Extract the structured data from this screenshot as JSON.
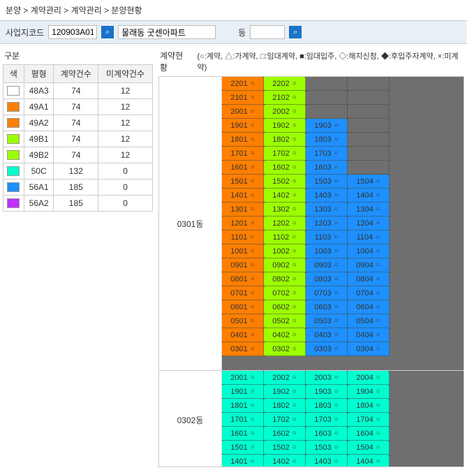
{
  "breadcrumb": "분양 > 계약관리 > 계약관리 > 분양현황",
  "filter": {
    "code_label": "사업지코드",
    "code_value": "120903A01",
    "name_value": "물래동 굿센아파트",
    "dong_label": "동",
    "dong_value": ""
  },
  "left": {
    "title": "구분",
    "headers": [
      "색",
      "평형",
      "계약건수",
      "미계약건수"
    ],
    "rows": [
      {
        "color": "#ffffff",
        "type": "48A3",
        "contract": 74,
        "nocontract": 12
      },
      {
        "color": "#ff7f00",
        "type": "49A1",
        "contract": 74,
        "nocontract": 12
      },
      {
        "color": "#ff7f00",
        "type": "49A2",
        "contract": 74,
        "nocontract": 12
      },
      {
        "color": "#9cff00",
        "type": "49B1",
        "contract": 74,
        "nocontract": 12
      },
      {
        "color": "#9cff00",
        "type": "49B2",
        "contract": 74,
        "nocontract": 12
      },
      {
        "color": "#00ffd0",
        "type": "50C",
        "contract": 132,
        "nocontract": 0
      },
      {
        "color": "#1e90ff",
        "type": "56A1",
        "contract": 185,
        "nocontract": 0
      },
      {
        "color": "#c030ff",
        "type": "56A2",
        "contract": 185,
        "nocontract": 0
      }
    ]
  },
  "right": {
    "title": "계약현황",
    "legend": "(○:계약, △:가계약, □:임대계약, ■:임대입주, ◇:해지신청, ◆:후입주자계약, ×:미계약)",
    "buildings": [
      {
        "name": "0301동",
        "sym": "○",
        "rows": [
          [
            {
              "u": "2201",
              "c": "#ff7f00"
            },
            {
              "u": "2202",
              "c": "#9cff00"
            },
            null,
            null
          ],
          [
            {
              "u": "2101",
              "c": "#ff7f00"
            },
            {
              "u": "2102",
              "c": "#9cff00"
            },
            null,
            null
          ],
          [
            {
              "u": "2001",
              "c": "#ff7f00"
            },
            {
              "u": "2002",
              "c": "#9cff00"
            },
            null,
            null
          ],
          [
            {
              "u": "1901",
              "c": "#ff7f00"
            },
            {
              "u": "1902",
              "c": "#9cff00"
            },
            {
              "u": "1903",
              "c": "#1e90ff"
            },
            null
          ],
          [
            {
              "u": "1801",
              "c": "#ff7f00"
            },
            {
              "u": "1802",
              "c": "#9cff00"
            },
            {
              "u": "1803",
              "c": "#1e90ff"
            },
            null
          ],
          [
            {
              "u": "1701",
              "c": "#ff7f00"
            },
            {
              "u": "1702",
              "c": "#9cff00"
            },
            {
              "u": "1703",
              "c": "#1e90ff"
            },
            null
          ],
          [
            {
              "u": "1601",
              "c": "#ff7f00"
            },
            {
              "u": "1602",
              "c": "#9cff00"
            },
            {
              "u": "1603",
              "c": "#1e90ff"
            },
            null
          ],
          [
            {
              "u": "1501",
              "c": "#ff7f00"
            },
            {
              "u": "1502",
              "c": "#9cff00"
            },
            {
              "u": "1503",
              "c": "#1e90ff"
            },
            {
              "u": "1504",
              "c": "#1e90ff"
            }
          ],
          [
            {
              "u": "1401",
              "c": "#ff7f00"
            },
            {
              "u": "1402",
              "c": "#9cff00"
            },
            {
              "u": "1403",
              "c": "#1e90ff"
            },
            {
              "u": "1404",
              "c": "#1e90ff"
            }
          ],
          [
            {
              "u": "1301",
              "c": "#ff7f00"
            },
            {
              "u": "1302",
              "c": "#9cff00"
            },
            {
              "u": "1303",
              "c": "#1e90ff"
            },
            {
              "u": "1304",
              "c": "#1e90ff"
            }
          ],
          [
            {
              "u": "1201",
              "c": "#ff7f00"
            },
            {
              "u": "1202",
              "c": "#9cff00"
            },
            {
              "u": "1203",
              "c": "#1e90ff"
            },
            {
              "u": "1204",
              "c": "#1e90ff"
            }
          ],
          [
            {
              "u": "1101",
              "c": "#ff7f00"
            },
            {
              "u": "1102",
              "c": "#9cff00"
            },
            {
              "u": "1103",
              "c": "#1e90ff"
            },
            {
              "u": "1104",
              "c": "#1e90ff"
            }
          ],
          [
            {
              "u": "1001",
              "c": "#ff7f00"
            },
            {
              "u": "1002",
              "c": "#9cff00"
            },
            {
              "u": "1003",
              "c": "#1e90ff"
            },
            {
              "u": "1004",
              "c": "#1e90ff"
            }
          ],
          [
            {
              "u": "0901",
              "c": "#ff7f00"
            },
            {
              "u": "0902",
              "c": "#9cff00"
            },
            {
              "u": "0903",
              "c": "#1e90ff"
            },
            {
              "u": "0904",
              "c": "#1e90ff"
            }
          ],
          [
            {
              "u": "0801",
              "c": "#ff7f00"
            },
            {
              "u": "0802",
              "c": "#9cff00"
            },
            {
              "u": "0803",
              "c": "#1e90ff"
            },
            {
              "u": "0804",
              "c": "#1e90ff"
            }
          ],
          [
            {
              "u": "0701",
              "c": "#ff7f00"
            },
            {
              "u": "0702",
              "c": "#9cff00"
            },
            {
              "u": "0703",
              "c": "#1e90ff"
            },
            {
              "u": "0704",
              "c": "#1e90ff"
            }
          ],
          [
            {
              "u": "0601",
              "c": "#ff7f00"
            },
            {
              "u": "0602",
              "c": "#9cff00"
            },
            {
              "u": "0603",
              "c": "#1e90ff"
            },
            {
              "u": "0604",
              "c": "#1e90ff"
            }
          ],
          [
            {
              "u": "0501",
              "c": "#ff7f00"
            },
            {
              "u": "0502",
              "c": "#9cff00"
            },
            {
              "u": "0503",
              "c": "#1e90ff"
            },
            {
              "u": "0504",
              "c": "#1e90ff"
            }
          ],
          [
            {
              "u": "0401",
              "c": "#ff7f00"
            },
            {
              "u": "0402",
              "c": "#9cff00"
            },
            {
              "u": "0403",
              "c": "#1e90ff"
            },
            {
              "u": "0404",
              "c": "#1e90ff"
            }
          ],
          [
            {
              "u": "0301",
              "c": "#ff7f00"
            },
            {
              "u": "0302",
              "c": "#9cff00"
            },
            {
              "u": "0303",
              "c": "#1e90ff"
            },
            {
              "u": "0304",
              "c": "#1e90ff"
            }
          ]
        ]
      },
      {
        "name": "0302동",
        "sym": "○",
        "rows": [
          [
            {
              "u": "2001",
              "c": "#00ffd0"
            },
            {
              "u": "2002",
              "c": "#00ffd0"
            },
            {
              "u": "2003",
              "c": "#00ffd0"
            },
            {
              "u": "2004",
              "c": "#00ffd0"
            }
          ],
          [
            {
              "u": "1901",
              "c": "#00ffd0"
            },
            {
              "u": "1902",
              "c": "#00ffd0"
            },
            {
              "u": "1903",
              "c": "#00ffd0"
            },
            {
              "u": "1904",
              "c": "#00ffd0"
            }
          ],
          [
            {
              "u": "1801",
              "c": "#00ffd0"
            },
            {
              "u": "1802",
              "c": "#00ffd0"
            },
            {
              "u": "1803",
              "c": "#00ffd0"
            },
            {
              "u": "1804",
              "c": "#00ffd0"
            }
          ],
          [
            {
              "u": "1701",
              "c": "#00ffd0"
            },
            {
              "u": "1702",
              "c": "#00ffd0"
            },
            {
              "u": "1703",
              "c": "#00ffd0"
            },
            {
              "u": "1704",
              "c": "#00ffd0"
            }
          ],
          [
            {
              "u": "1601",
              "c": "#00ffd0"
            },
            {
              "u": "1602",
              "c": "#00ffd0"
            },
            {
              "u": "1603",
              "c": "#00ffd0"
            },
            {
              "u": "1604",
              "c": "#00ffd0"
            }
          ],
          [
            {
              "u": "1501",
              "c": "#00ffd0"
            },
            {
              "u": "1502",
              "c": "#00ffd0"
            },
            {
              "u": "1503",
              "c": "#00ffd0"
            },
            {
              "u": "1504",
              "c": "#00ffd0"
            }
          ],
          [
            {
              "u": "1401",
              "c": "#00ffd0"
            },
            {
              "u": "1402",
              "c": "#00ffd0"
            },
            {
              "u": "1403",
              "c": "#00ffd0"
            },
            {
              "u": "1404",
              "c": "#00ffd0"
            }
          ]
        ]
      }
    ]
  }
}
